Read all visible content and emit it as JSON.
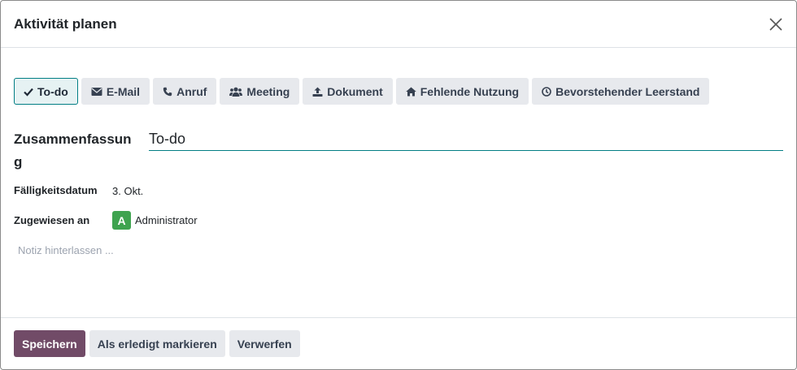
{
  "dialog": {
    "title": "Aktivität planen",
    "close_icon": "close-icon"
  },
  "activity_types": [
    {
      "label": "To-do",
      "icon": "check-icon",
      "active": true
    },
    {
      "label": "E-Mail",
      "icon": "envelope-icon",
      "active": false
    },
    {
      "label": "Anruf",
      "icon": "phone-icon",
      "active": false
    },
    {
      "label": "Meeting",
      "icon": "users-icon",
      "active": false
    },
    {
      "label": "Dokument",
      "icon": "upload-icon",
      "active": false
    },
    {
      "label": "Fehlende Nutzung",
      "icon": "home-icon",
      "active": false
    },
    {
      "label": "Bevorstehender Leerstand",
      "icon": "clock-icon",
      "active": false
    }
  ],
  "form": {
    "summary_label": "Zusammenfassung",
    "summary_value": "To-do",
    "due_date_label": "Fälligkeitsdatum",
    "due_date_value": "3. Okt.",
    "assigned_label": "Zugewiesen an",
    "assignee_initial": "A",
    "assignee_name": "Administrator",
    "note_placeholder": "Notiz hinterlassen ..."
  },
  "footer": {
    "save_label": "Speichern",
    "mark_done_label": "Als erledigt markieren",
    "discard_label": "Verwerfen"
  },
  "colors": {
    "primary": "#714b67",
    "accent": "#017e84",
    "avatar": "#3ea34f"
  }
}
